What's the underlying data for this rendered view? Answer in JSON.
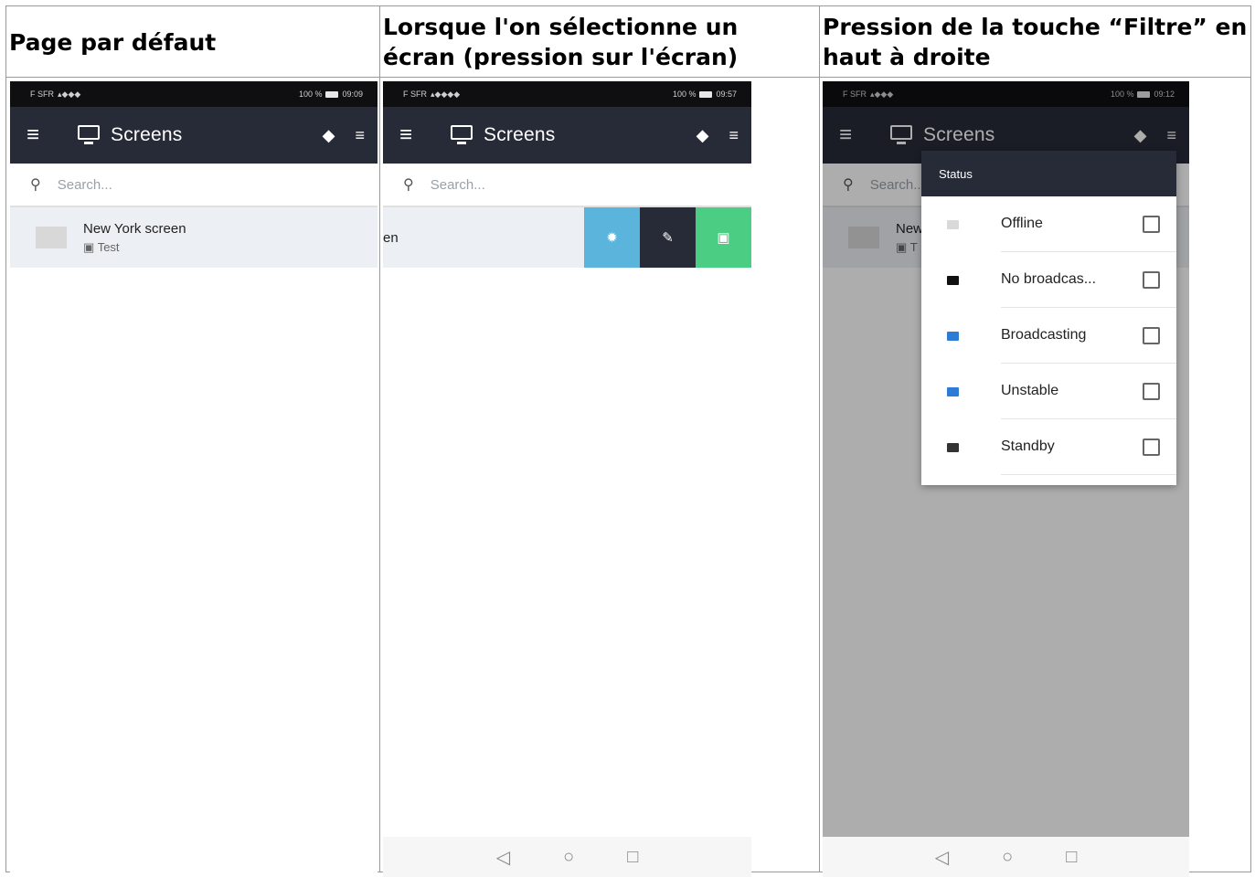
{
  "headers": {
    "col1": "Page par défaut",
    "col2": "Lorsque l'on sélectionne un écran (pression sur l'écran)",
    "col3": "Pression de la touche “Filtre” en haut à droite"
  },
  "phone": {
    "status_left": "F SFR",
    "phone1_time": "09:09",
    "phone2_time": "09:57",
    "phone3_time": "09:12",
    "battery_text": "100 %",
    "app_title": "Screens",
    "search_placeholder": "Search...",
    "screen_name": "New York screen",
    "screen_group": "Test",
    "row2_fragment": "en",
    "popup_row_name_fragment": "New",
    "popup_row_group_fragment": "T"
  },
  "filter": {
    "header": "Status",
    "options": [
      {
        "label": "Offline",
        "color": "#d9d9d9"
      },
      {
        "label": "No broadcas...",
        "color": "#111111"
      },
      {
        "label": "Broadcasting",
        "color": "#2e7bd6"
      },
      {
        "label": "Unstable",
        "color": "#2e7bd6"
      },
      {
        "label": "Standby",
        "color": "#333333"
      }
    ]
  },
  "colors": {
    "appbar": "#272b38",
    "action_settings": "#5ab4dc",
    "action_edit": "#272b38",
    "action_image": "#4bce84"
  },
  "icons": [
    "menu-icon",
    "monitor-icon",
    "tag-icon",
    "filter-icon",
    "search-icon",
    "gear-icon",
    "pencil-icon",
    "image-icon",
    "back-icon",
    "home-icon",
    "recents-icon"
  ]
}
